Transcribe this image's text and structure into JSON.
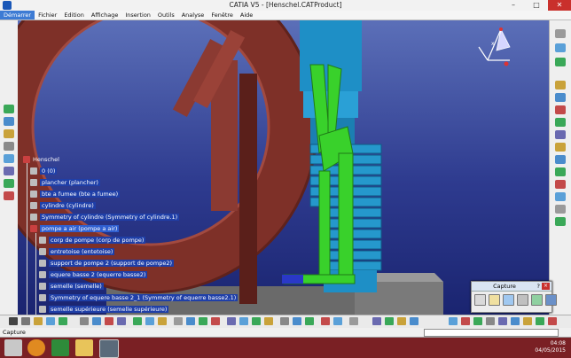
{
  "window": {
    "title": "CATIA V5 - [Henschel.CATProduct]"
  },
  "menu": [
    "Démarrer",
    "Fichier",
    "Edition",
    "Affichage",
    "Insertion",
    "Outils",
    "Analyse",
    "Fenêtre",
    "Aide"
  ],
  "tree": {
    "root": "Henschel",
    "nodes": [
      {
        "label": "0 (0)",
        "level": 1
      },
      {
        "label": "plancher (plancher)",
        "level": 1
      },
      {
        "label": "bte a fumee (bte a fumee)",
        "level": 1
      },
      {
        "label": "cylindre (cylindre)",
        "level": 1
      },
      {
        "label": "Symmetry of cylindre (Symmetry of cylindre.1)",
        "level": 1
      },
      {
        "label": "pompe a air (pompe a air)",
        "level": 1,
        "selected": true
      },
      {
        "label": "corp de pompe (corp de pompe)",
        "level": 2
      },
      {
        "label": "entretoise (entetoise)",
        "level": 2
      },
      {
        "label": "support de pompe 2 (support de pompe2)",
        "level": 2
      },
      {
        "label": "equere basse 2 (equerre basse2)",
        "level": 2
      },
      {
        "label": "semelle (semelle)",
        "level": 2
      },
      {
        "label": "Symmetry of equere basse 2_1 (Symmetry of equerre basse2.1)",
        "level": 2
      },
      {
        "label": "semelle supérieure (semelle supérieure)",
        "level": 2
      }
    ]
  },
  "compass": {
    "axis_label": "x"
  },
  "capture_panel": {
    "title": "Capture",
    "help_label": "?",
    "close_label": "×"
  },
  "status": {
    "label": "Capture"
  },
  "clock": {
    "time": "04:08",
    "date": "04/05/2015"
  },
  "colors": {
    "background_top": "#5b6fb8",
    "background_bottom": "#1a2470",
    "wheel": "#8b3a32",
    "cylinder": "#1e8fc6",
    "pump_green": "#39d12b",
    "taskbar": "#7a2024"
  }
}
